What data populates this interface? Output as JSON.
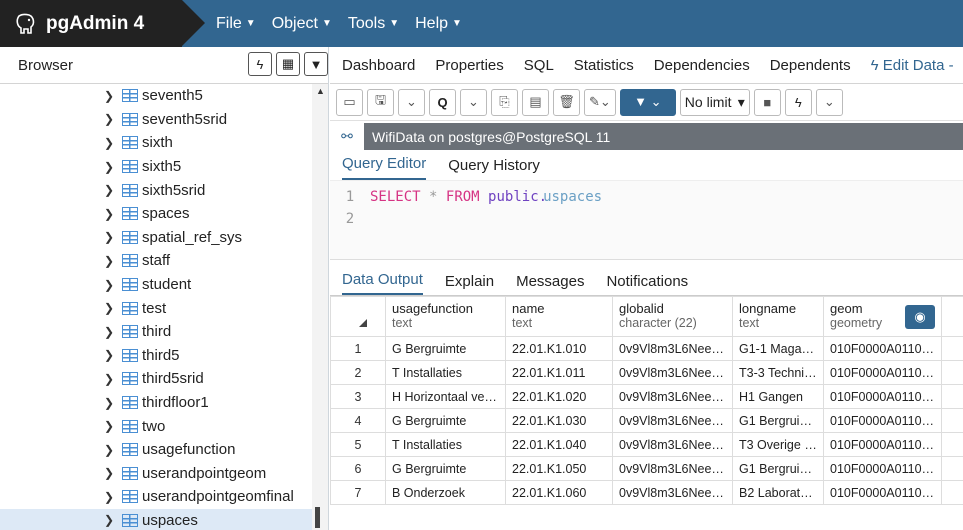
{
  "app": {
    "name": "pgAdmin 4"
  },
  "menu": [
    {
      "label": "File"
    },
    {
      "label": "Object"
    },
    {
      "label": "Tools"
    },
    {
      "label": "Help"
    }
  ],
  "browser": {
    "title": "Browser",
    "tools": [
      "lightning-icon",
      "grid-icon",
      "filter-icon"
    ],
    "items": [
      {
        "label": "seventh5"
      },
      {
        "label": "seventh5srid"
      },
      {
        "label": "sixth"
      },
      {
        "label": "sixth5"
      },
      {
        "label": "sixth5srid"
      },
      {
        "label": "spaces"
      },
      {
        "label": "spatial_ref_sys"
      },
      {
        "label": "staff"
      },
      {
        "label": "student"
      },
      {
        "label": "test"
      },
      {
        "label": "third"
      },
      {
        "label": "third5"
      },
      {
        "label": "third5srid"
      },
      {
        "label": "thirdfloor1"
      },
      {
        "label": "two"
      },
      {
        "label": "usagefunction"
      },
      {
        "label": "userandpointgeom"
      },
      {
        "label": "userandpointgeomfinal"
      },
      {
        "label": "uspaces",
        "selected": true
      }
    ]
  },
  "tabs": [
    {
      "label": "Dashboard"
    },
    {
      "label": "Properties"
    },
    {
      "label": "SQL"
    },
    {
      "label": "Statistics"
    },
    {
      "label": "Dependencies"
    },
    {
      "label": "Dependents"
    },
    {
      "label": "Edit Data -",
      "active": true
    }
  ],
  "toolbar": {
    "limit": "No limit"
  },
  "connection": {
    "text": "WifiData on postgres@PostgreSQL 11"
  },
  "query_tabs": [
    {
      "label": "Query Editor",
      "active": true
    },
    {
      "label": "Query History"
    }
  ],
  "editor": {
    "line_numbers": [
      "1",
      "2"
    ],
    "kw_select": "SELECT",
    "star": "*",
    "kw_from": "FROM",
    "schema": "public.",
    "table": "uspaces"
  },
  "output_tabs": [
    {
      "label": "Data Output",
      "active": true
    },
    {
      "label": "Explain"
    },
    {
      "label": "Messages"
    },
    {
      "label": "Notifications"
    }
  ],
  "grid": {
    "columns": [
      {
        "name": "usagefunction",
        "type": "text"
      },
      {
        "name": "name",
        "type": "text"
      },
      {
        "name": "globalid",
        "type": "character (22)"
      },
      {
        "name": "longname",
        "type": "text"
      },
      {
        "name": "geom",
        "type": "geometry"
      }
    ],
    "rows": [
      {
        "n": "1",
        "cells": [
          "G Bergruimte",
          "22.01.K1.010",
          "0v9Vl8m3L6Nee…",
          "G1-1 Magaz…",
          "010F0000A0110…"
        ]
      },
      {
        "n": "2",
        "cells": [
          "T Installaties",
          "22.01.K1.011",
          "0v9Vl8m3L6Nee…",
          "T3-3 Techni…",
          "010F0000A0110…"
        ]
      },
      {
        "n": "3",
        "cells": [
          "H Horizontaal ver…",
          "22.01.K1.020",
          "0v9Vl8m3L6Nee…",
          "H1 Gangen",
          "010F0000A0110…"
        ]
      },
      {
        "n": "4",
        "cells": [
          "G Bergruimte",
          "22.01.K1.030",
          "0v9Vl8m3L6Nee…",
          "G1 Bergruim…",
          "010F0000A0110…"
        ]
      },
      {
        "n": "5",
        "cells": [
          "T Installaties",
          "22.01.K1.040",
          "0v9Vl8m3L6Nee…",
          "T3 Overige i…",
          "010F0000A0110…"
        ]
      },
      {
        "n": "6",
        "cells": [
          "G Bergruimte",
          "22.01.K1.050",
          "0v9Vl8m3L6Nee…",
          "G1 Bergruim…",
          "010F0000A0110…"
        ]
      },
      {
        "n": "7",
        "cells": [
          "B Onderzoek",
          "22.01.K1.060",
          "0v9Vl8m3L6Nee…",
          "B2 Laborato…",
          "010F0000A0110…"
        ]
      }
    ]
  },
  "colors": {
    "accent": "#326690",
    "navbar": "#326690",
    "brand_bg": "#222222",
    "selection": "#dde9f6"
  }
}
